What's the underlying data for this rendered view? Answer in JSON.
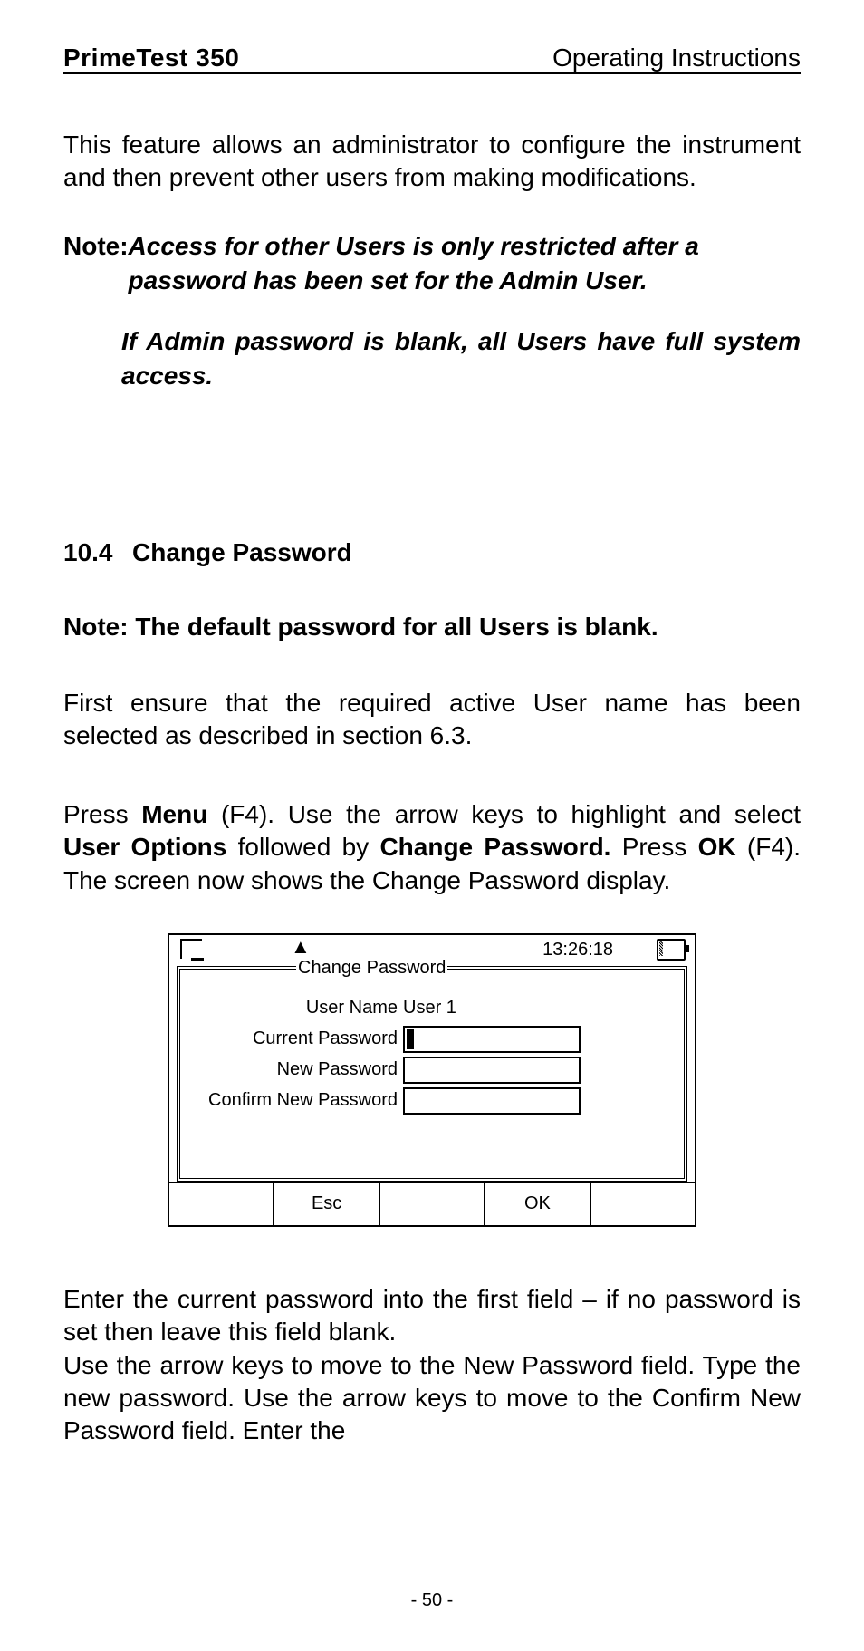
{
  "header": {
    "left": "PrimeTest 350",
    "right": "Operating Instructions"
  },
  "intro": "This feature allows an administrator to configure the instrument and then prevent other users from making modifications.",
  "note": {
    "label": "Note:",
    "line1": "Access for other Users is only restricted after a password has been set for the Admin User.",
    "line2": "If Admin password is blank, all Users have full system access."
  },
  "section": {
    "number": "10.4",
    "title": "Change Password"
  },
  "bold_note": "Note: The default password for all Users is blank.",
  "para1": "First ensure that the required active User name has been selected as described in section 6.3.",
  "para2_a": "Press ",
  "para2_b": "Menu",
  "para2_c": " (F4). Use the arrow keys to highlight and select ",
  "para2_d": "User Options",
  "para2_e": " followed by ",
  "para2_f": "Change Password.",
  "para2_g": " Press ",
  "para2_h": "OK",
  "para2_i": " (F4). The screen now shows the Change Password display.",
  "lcd": {
    "time": "13:26:18",
    "title": "Change Password",
    "user_label": "User Name",
    "user_value": "User 1",
    "current_label": "Current Password",
    "new_label": "New Password",
    "confirm_label": "Confirm New Password",
    "esc": "Esc",
    "ok": "OK"
  },
  "after": "Enter the current password into the first field – if no password is set then leave this field blank.\nUse the arrow keys to move to the New Password field. Type the new password. Use the arrow keys to move to the Confirm New Password field. Enter the",
  "page_number": "- 50 -"
}
